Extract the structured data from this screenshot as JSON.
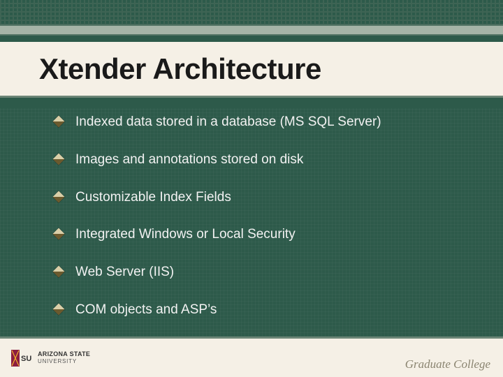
{
  "title": "Xtender Architecture",
  "bullets": [
    "Indexed data stored in a database (MS SQL Server)",
    "Images and annotations stored on disk",
    "Customizable Index Fields",
    "Integrated Windows or Local Security",
    "Web Server (IIS)",
    "COM objects and ASP’s"
  ],
  "footer": {
    "logo_line1": "ARIZONA STATE",
    "logo_line2": "UNIVERSITY",
    "right_text": "Graduate College"
  },
  "colors": {
    "background": "#2d5a4a",
    "panel": "#f5f0e6",
    "accent": "#6b8576",
    "bullet_diamond": "#b8a76a"
  }
}
